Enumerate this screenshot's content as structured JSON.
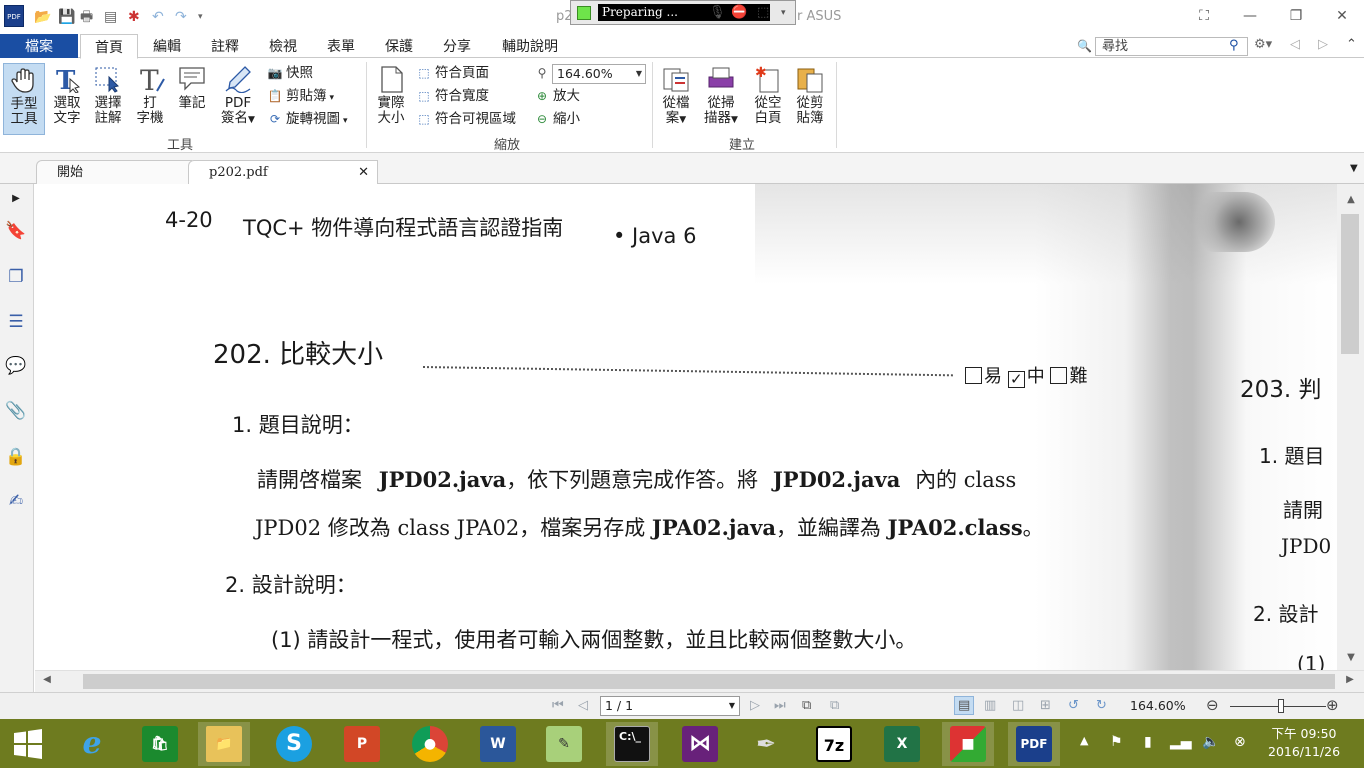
{
  "window": {
    "title_left": "p2",
    "title_right": "r ASUS",
    "recorder_status": "Preparing ..."
  },
  "menu": {
    "tabs": [
      "檔案",
      "首頁",
      "編輯",
      "註釋",
      "檢視",
      "表單",
      "保護",
      "分享",
      "輔助說明"
    ],
    "search_value": "尋找"
  },
  "ribbon": {
    "tools": {
      "hand_line1": "手型",
      "hand_line2": "工具",
      "select_text_line1": "選取",
      "select_text_line2": "文字",
      "select_annot_line1": "選擇",
      "select_annot_line2": "註解",
      "typewriter_line1": "打",
      "typewriter_line2": "字機",
      "note": "筆記",
      "pdf_sign_line1": "PDF",
      "pdf_sign_line2": "簽名",
      "snapshot": "快照",
      "clipboard": "剪貼簿",
      "rotate_view": "旋轉視圖",
      "group_label": "工具"
    },
    "zoom": {
      "actual_size_line1": "實際",
      "actual_size_line2": "大小",
      "fit_page": "符合頁面",
      "fit_width": "符合寬度",
      "fit_visible": "符合可視區域",
      "zoom_value": "164.60%",
      "zoom_in": "放大",
      "zoom_out": "縮小",
      "group_label": "縮放"
    },
    "create": {
      "from_file_line1": "從檔",
      "from_file_line2": "案",
      "from_scanner_line1": "從掃",
      "from_scanner_line2": "描器",
      "from_blank_line1": "從空",
      "from_blank_line2": "白頁",
      "from_clipboard_line1": "從剪",
      "from_clipboard_line2": "貼簿",
      "group_label": "建立"
    }
  },
  "doc_tabs": {
    "start": "開始",
    "file": "p202.pdf"
  },
  "document": {
    "header_page": "4-20",
    "header_title": "TQC+  物件導向程式語言認證指南",
    "header_java": "• Java 6",
    "section_title": "202.  比較大小",
    "difficulty_easy": "易",
    "difficulty_mid": "中",
    "difficulty_hard": "難",
    "h1": "1. 題目說明：",
    "p1_a": "請開啓檔案",
    "p1_b": "JPD02.java",
    "p1_c": "，依下列題意完成作答。將",
    "p1_d": "JPD02.java",
    "p1_e": "內的  class",
    "p2_a": "JPD02 修改為 class JPA02，檔案另存成",
    "p2_b": "JPA02.java",
    "p2_c": "，並編譯為",
    "p2_d": "JPA02.class",
    "p2_e": "。",
    "h2": "2. 設計說明：",
    "p3": "(1) 請設計一程式，使用者可輸入兩個整數，並且比較兩個整數大小。",
    "next_section": "203.  判",
    "next_h1": "1. 題目",
    "next_p1": "請開",
    "next_p2": "JPD0",
    "next_h2": "2. 設計",
    "next_p3": "(1)"
  },
  "status": {
    "page": "1 / 1",
    "zoom": "164.60%"
  },
  "taskbar": {
    "time": "下午 09:50",
    "date": "2016/11/26"
  }
}
